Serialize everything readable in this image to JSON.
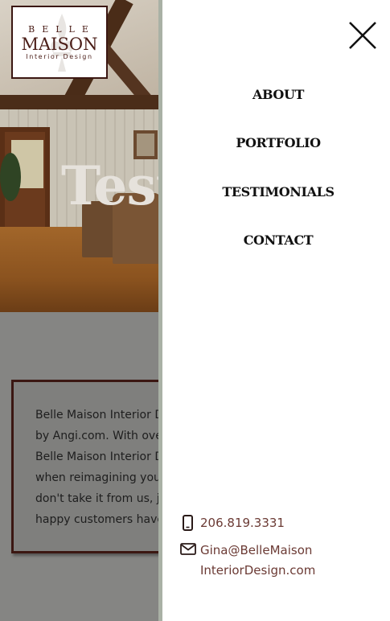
{
  "logo": {
    "line1": "BELLE",
    "line2": "MAISON",
    "line3": "Interior Design"
  },
  "hero": {
    "title": "Testi"
  },
  "intro_lines": [
    "Belle Maison Interior D",
    "by Angi.com. With ove",
    "Belle Maison Interior D",
    "when reimagining you",
    "don't take it from us, ju",
    "happy customers have"
  ],
  "menu": {
    "items": [
      {
        "label": "ABOUT"
      },
      {
        "label": "PORTFOLIO"
      },
      {
        "label": "TESTIMONIALS"
      },
      {
        "label": "CONTACT"
      }
    ]
  },
  "contact": {
    "phone": "206.819.3331",
    "email_line1": "Gina@BelleMaison",
    "email_line2": "InteriorDesign.com"
  },
  "icons": {
    "close": "close-icon",
    "phone": "mobile-phone-icon",
    "email": "envelope-icon"
  },
  "colors": {
    "brand": "#3b1712",
    "contact_text": "#6b3a34",
    "drawer_bg": "#ffffff"
  }
}
